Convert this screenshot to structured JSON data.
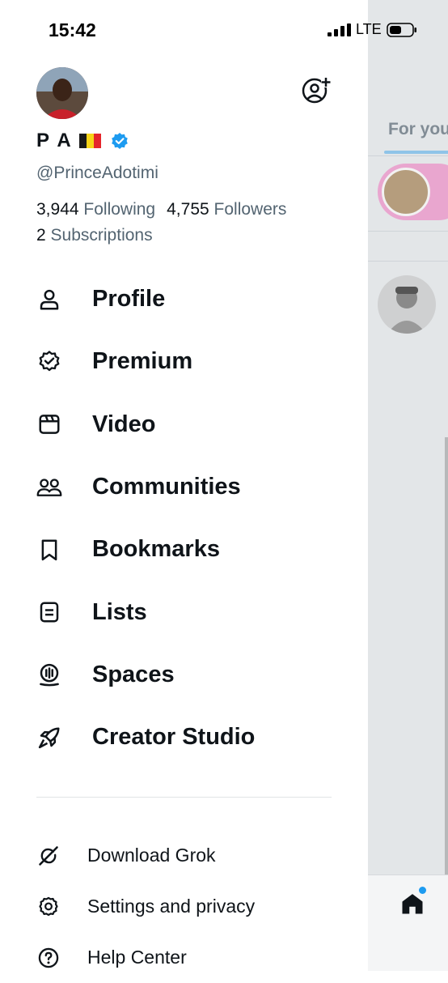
{
  "status_bar": {
    "time": "15:42",
    "network": "LTE"
  },
  "profile": {
    "display_name": "P A",
    "handle": "@PrinceAdotimi",
    "following_count": "3,944",
    "following_label": "Following",
    "followers_count": "4,755",
    "followers_label": "Followers",
    "subscriptions_count": "2",
    "subscriptions_label": "Subscriptions",
    "flag_colors": [
      "#1a1a1a",
      "#f7d417",
      "#e5252b"
    ],
    "verified_color": "#1d9bf0"
  },
  "menu": {
    "items": [
      {
        "label": "Profile",
        "icon": "person-icon"
      },
      {
        "label": "Premium",
        "icon": "premium-badge-icon"
      },
      {
        "label": "Video",
        "icon": "video-icon"
      },
      {
        "label": "Communities",
        "icon": "communities-icon"
      },
      {
        "label": "Bookmarks",
        "icon": "bookmark-icon"
      },
      {
        "label": "Lists",
        "icon": "lists-icon"
      },
      {
        "label": "Spaces",
        "icon": "spaces-icon"
      },
      {
        "label": "Creator Studio",
        "icon": "rocket-icon"
      }
    ]
  },
  "secondary_menu": {
    "items": [
      {
        "label": "Download Grok",
        "icon": "grok-icon"
      },
      {
        "label": "Settings and privacy",
        "icon": "gear-icon"
      },
      {
        "label": "Help Center",
        "icon": "help-icon"
      }
    ]
  },
  "feed": {
    "tab_label": "For you",
    "accent_color": "#1d9bf0"
  }
}
